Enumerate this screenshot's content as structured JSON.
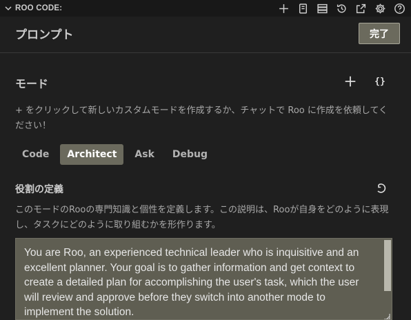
{
  "titlebar": {
    "title": "ROO CODE:",
    "actions": [
      "plus-icon",
      "history-notebook-icon",
      "server-icon",
      "history-icon",
      "popout-icon",
      "gear-icon",
      "help-icon"
    ]
  },
  "header": {
    "title": "プロンプト",
    "done_label": "完了"
  },
  "modes": {
    "title": "モード",
    "add_icon": "plus-icon",
    "edit_json_label": "{}",
    "hint": "+ をクリックして新しいカスタムモードを作成するか、チャットで Roo に作成を依頼してください！",
    "tabs": [
      {
        "label": "Code",
        "active": false
      },
      {
        "label": "Architect",
        "active": true
      },
      {
        "label": "Ask",
        "active": false
      },
      {
        "label": "Debug",
        "active": false
      }
    ]
  },
  "role": {
    "title": "役割の定義",
    "reset_icon": "reset-icon",
    "description": "このモードのRooの専門知識と個性を定義します。この説明は、Rooが自身をどのように表現し、タスクにどのように取り組むかを形作ります。",
    "value": "You are Roo, an experienced technical leader who is inquisitive and an excellent planner. Your goal is to gather information and get context to create a detailed plan for accomplishing the user's task, which the user will review and approve before they switch into another mode to implement the solution."
  },
  "colors": {
    "background": "#1f1f1f",
    "titlebar": "#181818",
    "accent": "#6b6a5d",
    "textarea": "#5f5e52"
  }
}
